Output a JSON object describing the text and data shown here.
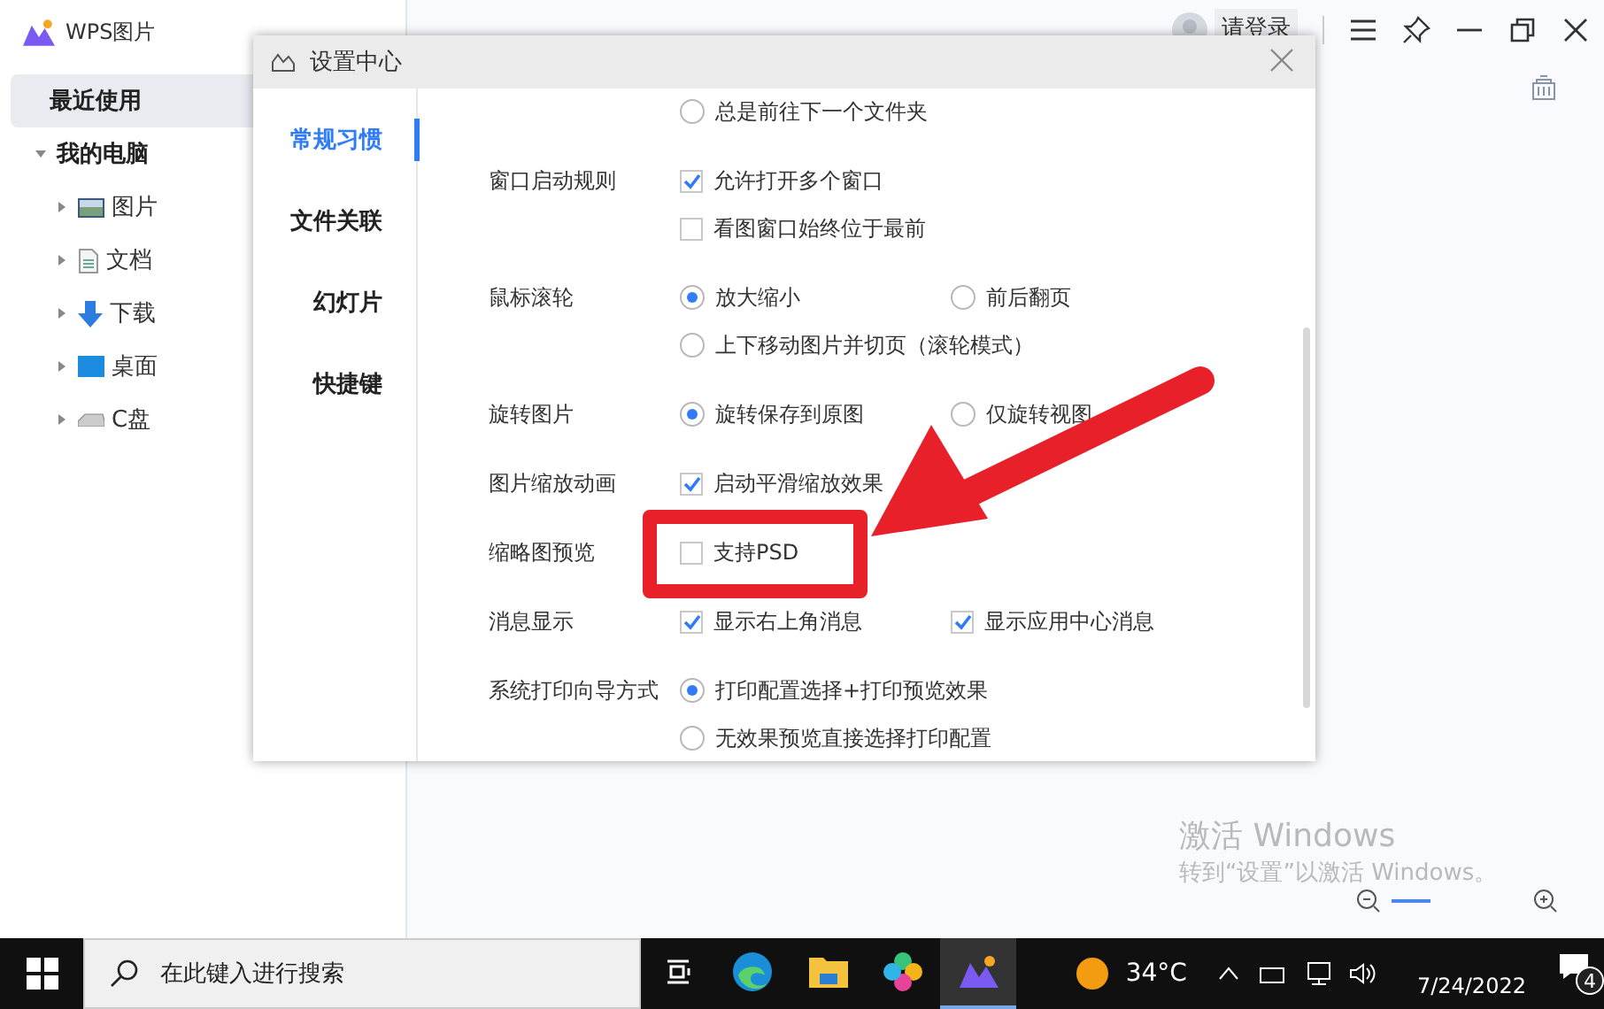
{
  "app": {
    "title": "WPS图片",
    "login": "请登录"
  },
  "sidebar": {
    "items": [
      {
        "label": "最近使用",
        "selected": true
      }
    ],
    "tree": {
      "label": "我的电脑",
      "expanded": true,
      "children": [
        {
          "label": "图片",
          "kind": "pictures",
          "expanded": false
        },
        {
          "label": "文档",
          "kind": "documents",
          "expanded": false
        },
        {
          "label": "下载",
          "kind": "downloads",
          "expanded": false
        },
        {
          "label": "桌面",
          "kind": "desktop",
          "expanded": false
        },
        {
          "label": "C盘",
          "kind": "drive",
          "expanded": false
        }
      ]
    }
  },
  "dialog": {
    "title": "设置中心",
    "nav": [
      {
        "label": "常规习惯",
        "selected": true
      },
      {
        "label": "文件关联",
        "selected": false
      },
      {
        "label": "幻灯片",
        "selected": false
      },
      {
        "label": "快捷键",
        "selected": false
      }
    ],
    "rows": [
      {
        "highlighted": false,
        "lines": [
          [
            {
              "kind": "radio",
              "text": "总是前往下一个文件夹",
              "checked": false
            }
          ]
        ]
      },
      {
        "label": "窗口启动规则",
        "highlighted": false,
        "lines": [
          [
            {
              "kind": "checkbox",
              "text": "允许打开多个窗口",
              "checked": true
            }
          ],
          [
            {
              "kind": "checkbox",
              "text": "看图窗口始终位于最前",
              "checked": false
            }
          ]
        ]
      },
      {
        "label": "鼠标滚轮",
        "highlighted": false,
        "lines": [
          [
            {
              "kind": "radio",
              "text": "放大缩小",
              "checked": true
            },
            {
              "kind": "radio",
              "text": "前后翻页",
              "checked": false
            }
          ],
          [
            {
              "kind": "radio",
              "text": "上下移动图片并切页（滚轮模式）",
              "checked": false
            }
          ]
        ]
      },
      {
        "label": "旋转图片",
        "highlighted": false,
        "lines": [
          [
            {
              "kind": "radio",
              "text": "旋转保存到原图",
              "checked": true
            },
            {
              "kind": "radio",
              "text": "仅旋转视图",
              "checked": false
            }
          ]
        ]
      },
      {
        "label": "图片缩放动画",
        "highlighted": false,
        "lines": [
          [
            {
              "kind": "checkbox",
              "text": "启动平滑缩放效果",
              "checked": true
            }
          ]
        ]
      },
      {
        "label": "缩略图预览",
        "highlighted": true,
        "lines": [
          [
            {
              "kind": "checkbox",
              "text": "支持PSD",
              "checked": false
            }
          ]
        ]
      },
      {
        "label": "消息显示",
        "highlighted": false,
        "lines": [
          [
            {
              "kind": "checkbox",
              "text": "显示右上角消息",
              "checked": true
            },
            {
              "kind": "checkbox",
              "text": "显示应用中心消息",
              "checked": true
            }
          ]
        ]
      },
      {
        "label": "系统打印向导方式",
        "highlighted": false,
        "lines": [
          [
            {
              "kind": "radio",
              "text": "打印配置选择+打印预览效果",
              "checked": true
            }
          ],
          [
            {
              "kind": "radio",
              "text": "无效果预览直接选择打印配置",
              "checked": false
            }
          ]
        ]
      }
    ]
  },
  "zoom": {
    "level": 0.3
  },
  "activation": {
    "title": "激活 Windows",
    "subtitle": "转到“设置”以激活 Windows。"
  },
  "taskbar": {
    "search": {
      "placeholder": "在此键入进行搜索"
    },
    "apps": [
      {
        "kind": "task-view",
        "selected": false
      },
      {
        "kind": "edge",
        "selected": false
      },
      {
        "kind": "explorer",
        "selected": false
      },
      {
        "kind": "pinwheel",
        "selected": false
      },
      {
        "kind": "wps-photo",
        "selected": true
      }
    ],
    "weather": "34°C",
    "date": "7/24/2022",
    "notifications": "4"
  }
}
